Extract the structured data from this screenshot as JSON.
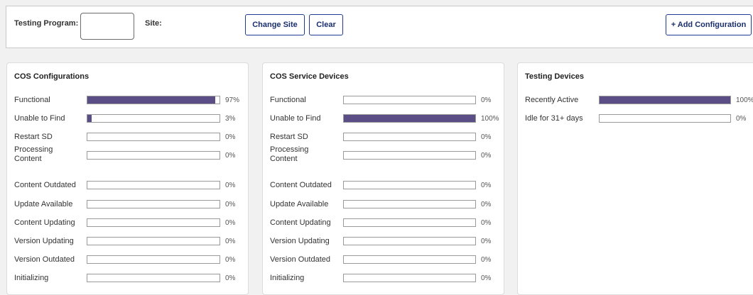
{
  "toolbar": {
    "testing_program_label": "Testing Program:",
    "testing_program_value": "",
    "site_label": "Site:",
    "change_site_label": "Change Site",
    "clear_label": "Clear",
    "add_config_label": "+ Add Configuration"
  },
  "colors": {
    "bar_fill": "#5b4e87",
    "button_border": "#1f3a93"
  },
  "panels": [
    {
      "title": "COS Configurations",
      "rows": [
        {
          "label": "Functional",
          "percent": 97,
          "percent_label": "97%"
        },
        {
          "label": "Unable to Find",
          "percent": 3,
          "percent_label": "3%"
        },
        {
          "label": "Restart SD",
          "percent": 0,
          "percent_label": "0%"
        },
        {
          "label": "Processing Content",
          "percent": 0,
          "percent_label": "0%"
        },
        {
          "label": "Content Outdated",
          "percent": 0,
          "percent_label": "0%"
        },
        {
          "label": "Update Available",
          "percent": 0,
          "percent_label": "0%"
        },
        {
          "label": "Content Updating",
          "percent": 0,
          "percent_label": "0%"
        },
        {
          "label": "Version Updating",
          "percent": 0,
          "percent_label": "0%"
        },
        {
          "label": "Version Outdated",
          "percent": 0,
          "percent_label": "0%"
        },
        {
          "label": "Initializing",
          "percent": 0,
          "percent_label": "0%"
        }
      ]
    },
    {
      "title": "COS Service Devices",
      "rows": [
        {
          "label": "Functional",
          "percent": 0,
          "percent_label": "0%"
        },
        {
          "label": "Unable to Find",
          "percent": 100,
          "percent_label": "100%"
        },
        {
          "label": "Restart SD",
          "percent": 0,
          "percent_label": "0%"
        },
        {
          "label": "Processing Content",
          "percent": 0,
          "percent_label": "0%"
        },
        {
          "label": "Content Outdated",
          "percent": 0,
          "percent_label": "0%"
        },
        {
          "label": "Update Available",
          "percent": 0,
          "percent_label": "0%"
        },
        {
          "label": "Content Updating",
          "percent": 0,
          "percent_label": "0%"
        },
        {
          "label": "Version Updating",
          "percent": 0,
          "percent_label": "0%"
        },
        {
          "label": "Version Outdated",
          "percent": 0,
          "percent_label": "0%"
        },
        {
          "label": "Initializing",
          "percent": 0,
          "percent_label": "0%"
        }
      ]
    },
    {
      "title": "Testing Devices",
      "rows": [
        {
          "label": "Recently Active",
          "percent": 100,
          "percent_label": "100%"
        },
        {
          "label": "Idle for 31+ days",
          "percent": 0,
          "percent_label": "0%"
        }
      ]
    }
  ]
}
